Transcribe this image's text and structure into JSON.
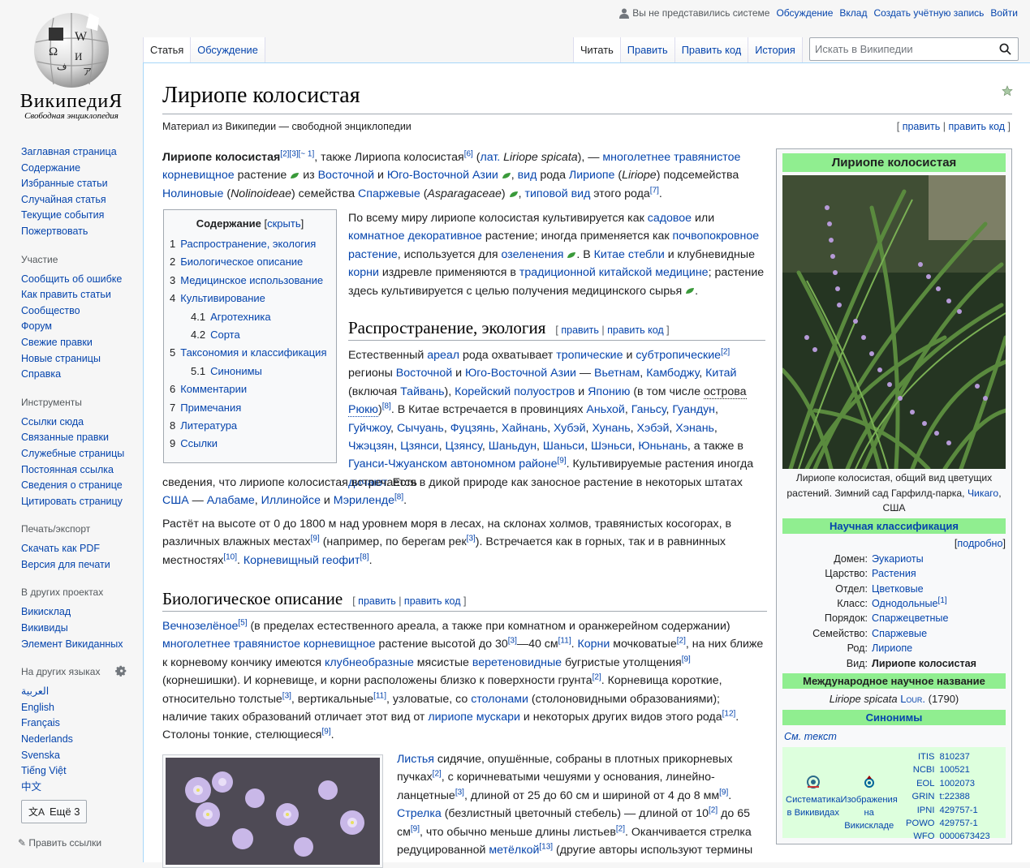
{
  "logo": {
    "wordmark": "ВикипедиЯ",
    "tagline": "Свободная энциклопедия"
  },
  "personal": {
    "anon": "Вы не представились системе",
    "talk": "Обсуждение",
    "contributions": "Вклад",
    "create_account": "Создать учётную запись",
    "login": "Войти"
  },
  "tabs": {
    "article": "Статья",
    "talk": "Обсуждение",
    "read": "Читать",
    "edit": "Править",
    "edit_source": "Править код",
    "history": "История"
  },
  "search": {
    "placeholder": "Искать в Википедии"
  },
  "sidebar": {
    "main": [
      "Заглавная страница",
      "Содержание",
      "Избранные статьи",
      "Случайная статья",
      "Текущие события",
      "Пожертвовать"
    ],
    "participation": {
      "title": "Участие",
      "items": [
        "Сообщить об ошибке",
        "Как править статьи",
        "Сообщество",
        "Форум",
        "Свежие правки",
        "Новые страницы",
        "Справка"
      ]
    },
    "tools": {
      "title": "Инструменты",
      "items": [
        "Ссылки сюда",
        "Связанные правки",
        "Служебные страницы",
        "Постоянная ссылка",
        "Сведения о странице",
        "Цитировать страницу"
      ]
    },
    "print": {
      "title": "Печать/экспорт",
      "items": [
        "Скачать как PDF",
        "Версия для печати"
      ]
    },
    "projects": {
      "title": "В других проектах",
      "items": [
        "Викисклад",
        "Викивиды",
        "Элемент Викиданных"
      ]
    },
    "languages": {
      "title": "На других языках",
      "items": [
        "العربية",
        "English",
        "Français",
        "Nederlands",
        "Svenska",
        "Tiếng Việt",
        "中文"
      ],
      "more": "Ещё 3",
      "edit_links": "Править ссылки"
    }
  },
  "article": {
    "title": "Лириопе колосистая",
    "site_sub": "Материал из Википедии — свободной энциклопедии",
    "top_edit": {
      "edit": "править",
      "edit_source": "править код"
    },
    "toc": {
      "title": "Содержание",
      "hide": "скрыть",
      "items": [
        {
          "n": "1",
          "t": "Распространение, экология",
          "sub": false
        },
        {
          "n": "2",
          "t": "Биологическое описание",
          "sub": false
        },
        {
          "n": "3",
          "t": "Медицинское использование",
          "sub": false
        },
        {
          "n": "4",
          "t": "Культивирование",
          "sub": false
        },
        {
          "n": "4.1",
          "t": "Агротехника",
          "sub": true
        },
        {
          "n": "4.2",
          "t": "Сорта",
          "sub": true
        },
        {
          "n": "5",
          "t": "Таксономия и классификация",
          "sub": false
        },
        {
          "n": "5.1",
          "t": "Синонимы",
          "sub": true
        },
        {
          "n": "6",
          "t": "Комментарии",
          "sub": false
        },
        {
          "n": "7",
          "t": "Примечания",
          "sub": false
        },
        {
          "n": "8",
          "t": "Литература",
          "sub": false
        },
        {
          "n": "9",
          "t": "Ссылки",
          "sub": false
        }
      ]
    },
    "sections": {
      "distribution": "Распространение, экология",
      "description": "Биологическое описание",
      "edit": "править",
      "edit_source": "править код"
    },
    "thumb2_alt": ""
  },
  "infobox": {
    "title": "Лириопе колосистая",
    "caption_pre": "Лириопе колосистая, общий вид цветущих растений. Зимний сад Гарфилд-парка, ",
    "caption_link": "Чикаго",
    "caption_post": ", США",
    "sci_class": "Научная классификация",
    "more": "подробно",
    "rows": [
      {
        "k": "Домен:",
        "v": "Эукариоты"
      },
      {
        "k": "Царство:",
        "v": "Растения"
      },
      {
        "k": "Отдел:",
        "v": "Цветковые"
      },
      {
        "k": "Класс:",
        "v": "Однодольные",
        "sup": "[1]"
      },
      {
        "k": "Порядок:",
        "v": "Спаржецветные"
      },
      {
        "k": "Семейство:",
        "v": "Спаржевые"
      },
      {
        "k": "Род:",
        "v": "Лириопе"
      },
      {
        "k": "Вид:",
        "v": "Лириопе колосистая",
        "bold": true
      }
    ],
    "intl_name": "Международное научное название",
    "latin": "Liriope spicata",
    "author": "Lour.",
    "year": "(1790)",
    "synonyms": "Синонимы",
    "see_text": "См. текст",
    "wikispecies": "Систематика в Викивидах",
    "commons": "Изображения на Викискладе",
    "ids": [
      {
        "k": "ITIS",
        "v": "810237"
      },
      {
        "k": "NCBI",
        "v": "100521"
      },
      {
        "k": "EOL",
        "v": "1002073"
      },
      {
        "k": "GRIN",
        "v": "t:22388"
      },
      {
        "k": "IPNI",
        "v": "429757-1"
      },
      {
        "k": "POWO",
        "v": "429757-1"
      },
      {
        "k": "WFO",
        "v": "0000673423"
      }
    ]
  },
  "colors": {
    "link": "#0645ad",
    "infobox_header": "#90ee90",
    "content_border": "#a7d7f9",
    "sidebar_bg": "#f6f6f6"
  }
}
